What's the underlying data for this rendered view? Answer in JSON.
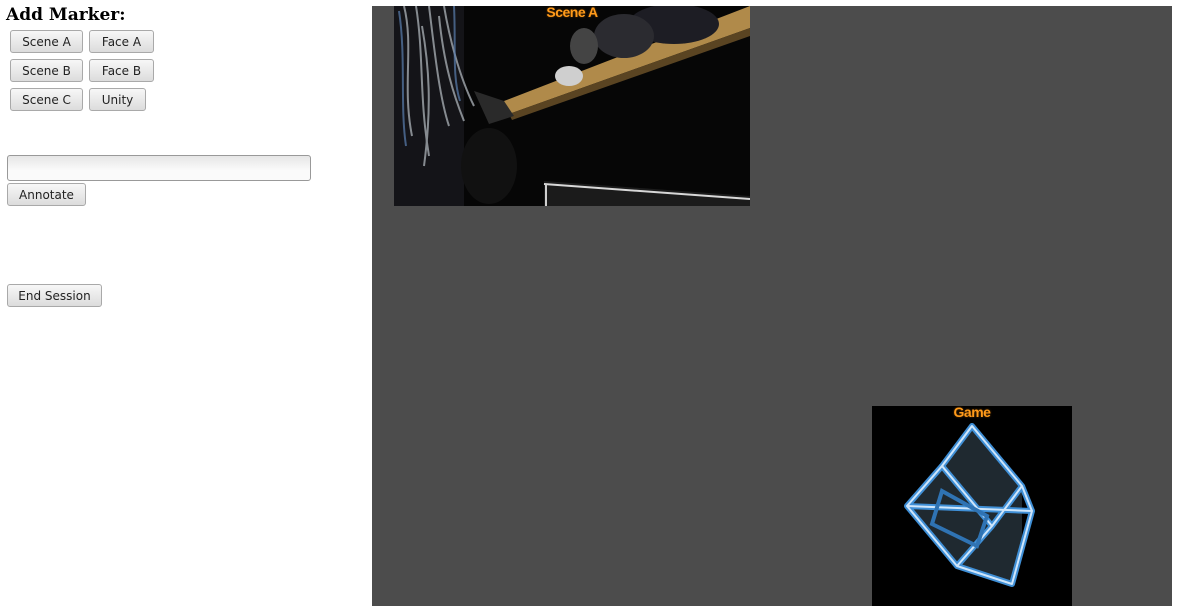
{
  "sidebar": {
    "heading": "Add Marker:",
    "marker_buttons": [
      "Scene A",
      "Face A",
      "Scene B",
      "Face B",
      "Scene C",
      "Unity"
    ],
    "annotation_input": {
      "value": "",
      "placeholder": ""
    },
    "annotate_label": "Annotate",
    "end_session_label": "End Session"
  },
  "stage": {
    "scene_feed": {
      "label": "Scene A"
    },
    "game_feed": {
      "label": "Game"
    }
  },
  "colors": {
    "stage_background": "#4c4c4c",
    "overlay_label": "#ff9a1a",
    "cube_edge": "#3f8fd6"
  },
  "icons": {
    "game_feed_graphic": "wireframe-cube-icon"
  }
}
